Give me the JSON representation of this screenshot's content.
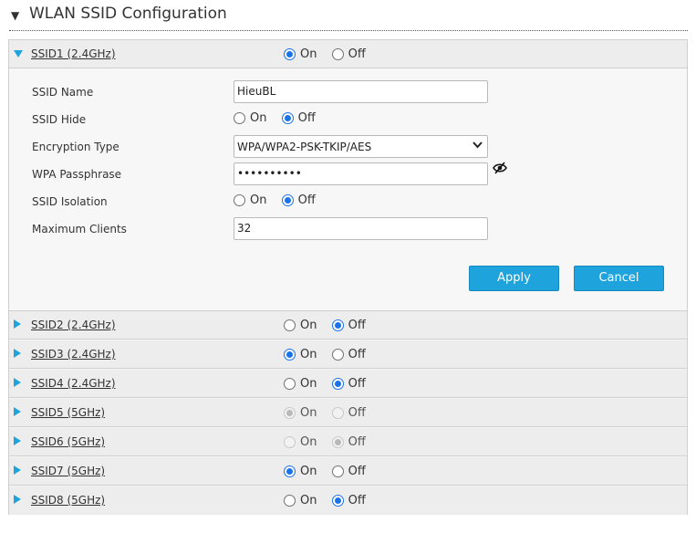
{
  "section": {
    "title": "WLAN SSID Configuration",
    "caret_icon": "triangle-down-icon"
  },
  "ssids": [
    {
      "name": "SSID1 (2.4GHz)",
      "expanded": true,
      "state": "on",
      "disabled": false
    },
    {
      "name": "SSID2 (2.4GHz)",
      "expanded": false,
      "state": "off",
      "disabled": false
    },
    {
      "name": "SSID3 (2.4GHz)",
      "expanded": false,
      "state": "on",
      "disabled": false
    },
    {
      "name": "SSID4 (2.4GHz)",
      "expanded": false,
      "state": "off",
      "disabled": false
    },
    {
      "name": "SSID5 (5GHz)",
      "expanded": false,
      "state": "on",
      "disabled": true
    },
    {
      "name": "SSID6 (5GHz)",
      "expanded": false,
      "state": "off",
      "disabled": true
    },
    {
      "name": "SSID7 (5GHz)",
      "expanded": false,
      "state": "on",
      "disabled": false
    },
    {
      "name": "SSID8 (5GHz)",
      "expanded": false,
      "state": "off",
      "disabled": false
    }
  ],
  "radio": {
    "on_label": "On",
    "off_label": "Off"
  },
  "detail": {
    "ssid_name_label": "SSID Name",
    "ssid_name_value": "HieuBL",
    "ssid_hide_label": "SSID Hide",
    "ssid_hide_state": "off",
    "encryption_label": "Encryption Type",
    "encryption_value": "WPA/WPA2-PSK-TKIP/AES",
    "passphrase_label": "WPA Passphrase",
    "passphrase_value": "••••••••••",
    "isolation_label": "SSID Isolation",
    "isolation_state": "off",
    "max_clients_label": "Maximum Clients",
    "max_clients_value": "32",
    "apply_label": "Apply",
    "cancel_label": "Cancel"
  },
  "colors": {
    "accent": "#1fa3dd",
    "radio_checked": "#1a73e8"
  }
}
